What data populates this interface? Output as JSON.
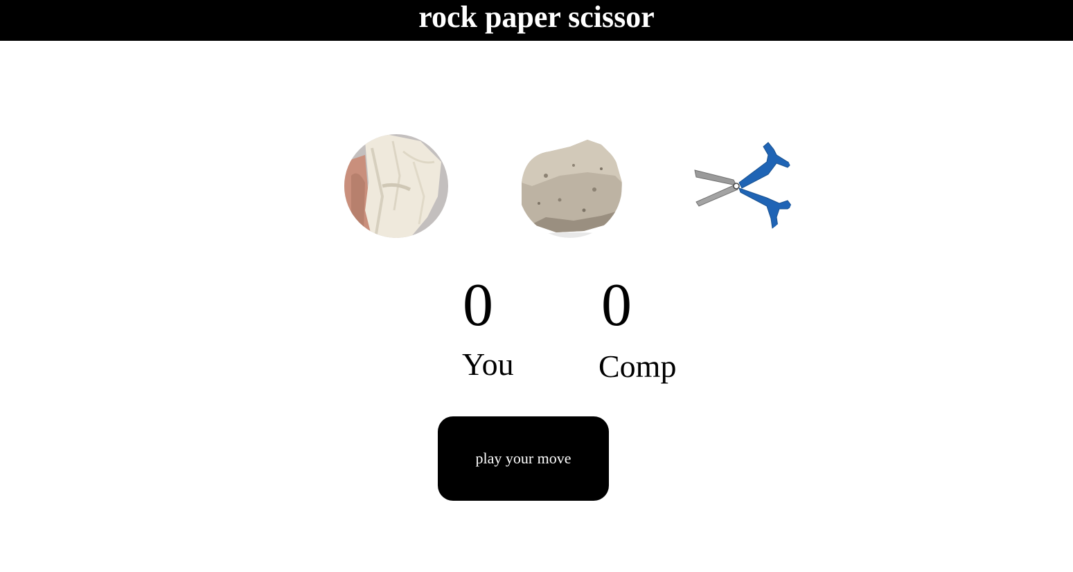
{
  "header": {
    "title": "rock paper scissor"
  },
  "choices": [
    {
      "id": "paper",
      "icon": "paper-image"
    },
    {
      "id": "rock",
      "icon": "rock-image"
    },
    {
      "id": "scissor",
      "icon": "scissor-image"
    }
  ],
  "scoreboard": {
    "user_score": "0",
    "user_label": "You",
    "comp_score": "0",
    "comp_label": "Comp"
  },
  "message": {
    "text": "play your move"
  },
  "colors": {
    "header_bg": "#000000",
    "header_text": "#ffffff",
    "message_bg": "#000000",
    "message_text": "#ffffff",
    "scissor_handle": "#1f64b5"
  }
}
